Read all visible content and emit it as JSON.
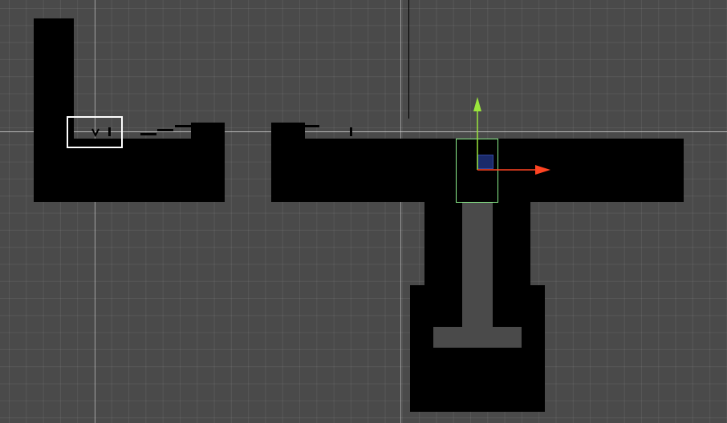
{
  "scene_view": {
    "background_color": "#4a4a4a",
    "grid_color": "#5a5a5a",
    "tile_color": "#000000",
    "selection_color": "#ffffff",
    "collider_color": "#8cf08c",
    "gizmo": {
      "y_axis_color": "#9be63c",
      "x_axis_color": "#ff4422",
      "center_color": "#1a2a6a"
    }
  }
}
